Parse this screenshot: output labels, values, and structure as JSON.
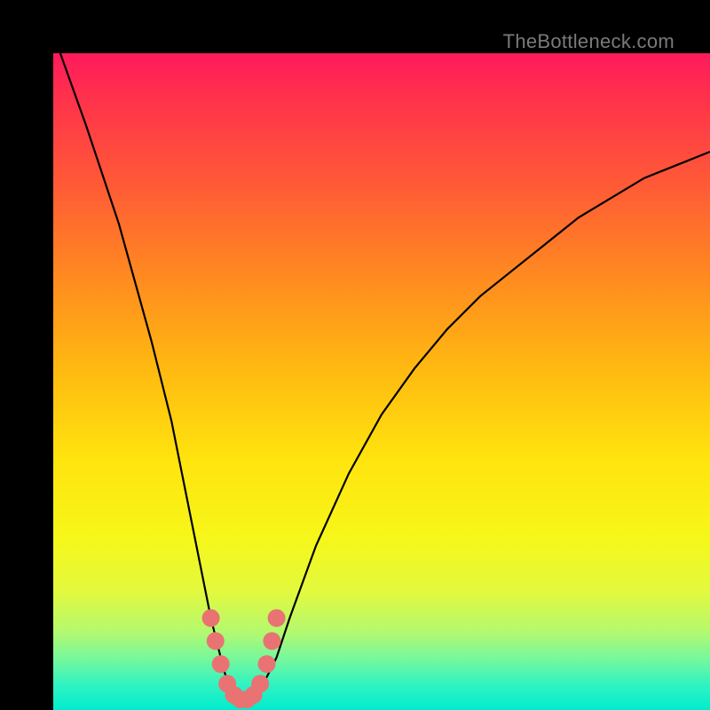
{
  "watermark": {
    "text": "TheBottleneck.com"
  },
  "chart_data": {
    "type": "line",
    "title": "",
    "xlabel": "",
    "ylabel": "",
    "xlim": [
      0,
      100
    ],
    "ylim": [
      0,
      100
    ],
    "series": [
      {
        "name": "bottleneck-curve",
        "x": [
          0,
          5,
          10,
          15,
          18,
          20,
          22,
          24,
          26,
          27,
          28,
          30,
          32,
          34,
          36,
          40,
          45,
          50,
          55,
          60,
          65,
          70,
          75,
          80,
          85,
          90,
          95,
          100
        ],
        "values": [
          103,
          89,
          74,
          56,
          44,
          34,
          24,
          14,
          6,
          3,
          2,
          2,
          4,
          8,
          14,
          25,
          36,
          45,
          52,
          58,
          63,
          67,
          71,
          75,
          78,
          81,
          83,
          85
        ]
      }
    ],
    "highlight": {
      "name": "optimal-zone",
      "x": [
        24.0,
        24.7,
        25.5,
        26.5,
        27.5,
        28.5,
        29.5,
        30.5,
        31.5,
        32.5,
        33.3,
        34.0
      ],
      "values": [
        14.0,
        10.5,
        7.0,
        4.0,
        2.3,
        1.6,
        1.6,
        2.3,
        4.0,
        7.0,
        10.5,
        14.0
      ]
    },
    "background": {
      "gradient_stops": [
        {
          "offset": 0,
          "color": "#ff1a5c"
        },
        {
          "offset": 20,
          "color": "#ff5a36"
        },
        {
          "offset": 48,
          "color": "#ffb911"
        },
        {
          "offset": 74,
          "color": "#f6f71a"
        },
        {
          "offset": 92,
          "color": "#7af89a"
        },
        {
          "offset": 100,
          "color": "#00eccf"
        }
      ]
    }
  }
}
